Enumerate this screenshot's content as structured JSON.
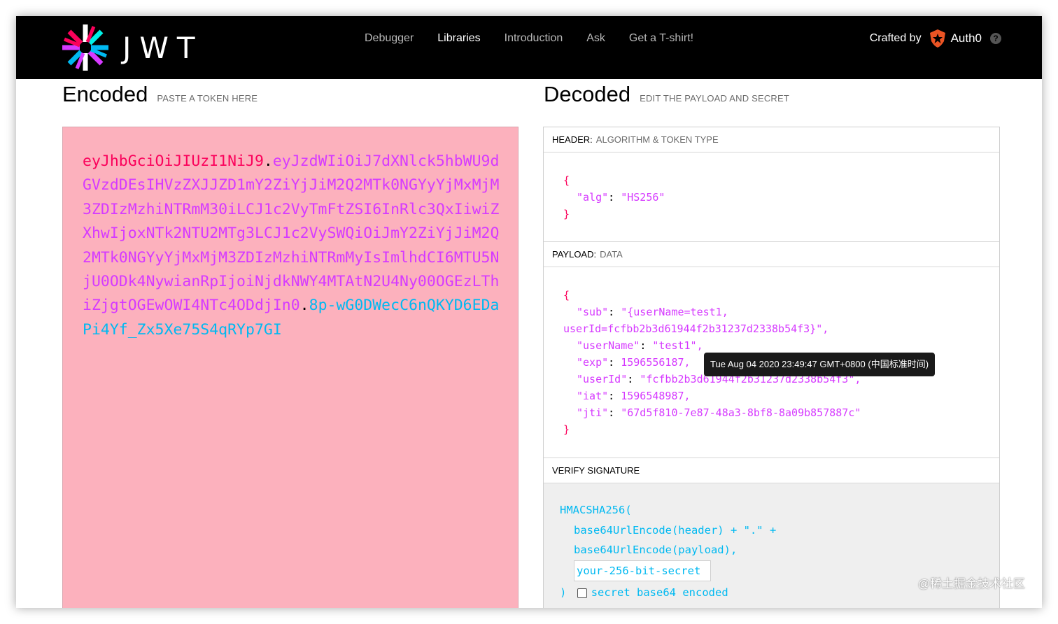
{
  "nav": {
    "logo_text": "JWT",
    "items": [
      {
        "label": "Debugger",
        "active": false
      },
      {
        "label": "Libraries",
        "active": true
      },
      {
        "label": "Introduction",
        "active": false
      },
      {
        "label": "Ask",
        "active": false
      },
      {
        "label": "Get a T-shirt!",
        "active": false
      }
    ],
    "crafted_by": "Crafted by",
    "auth0": "Auth0",
    "help": "?"
  },
  "encoded": {
    "title": "Encoded",
    "subtitle": "PASTE A TOKEN HERE",
    "header_part": "eyJhbGciOiJIUzI1NiJ9",
    "payload_part": "eyJzdWIiOiJ7dXNlck5hbWU9dGVzdDEsIHVzZXJJZD1mY2ZiYjJiM2Q2MTk0NGYyYjMxMjM3ZDIzMzhiNTRmM30iLCJ1c2VyTmFtZSI6InRlc3QxIiwiZXhwIjoxNTk2NTU2MTg3LCJ1c2VySWQiOiJmY2ZiYjJiM2Q2MTk0NGYyYjMxMjM3ZDIzMzhiNTRmMyIsImlhdCI6MTU5NjU0ODk4NywianRpIjoiNjdkNWY4MTAtN2U4Ny00OGEzLThiZjgtOGEwOWI4NTc4ODdjIn0",
    "signature_part": "8p-wG0DWecC6nQKYD6EDaPi4Yf_Zx5Xe75S4qRYp7GI",
    "dot": "."
  },
  "decoded": {
    "title": "Decoded",
    "subtitle": "EDIT THE PAYLOAD AND SECRET",
    "header_section": {
      "label": "HEADER:",
      "sub": "ALGORITHM & TOKEN TYPE"
    },
    "header_json": {
      "alg_key": "\"alg\"",
      "alg_val": "\"HS256\""
    },
    "payload_section": {
      "label": "PAYLOAD:",
      "sub": "DATA"
    },
    "payload_json": {
      "sub_key": "\"sub\"",
      "sub_val_1": "\"{userName=test1,",
      "sub_val_2": "userId=fcfbb2b3d61944f2b31237d2338b54f3}\",",
      "userName_key": "\"userName\"",
      "userName_val": "\"test1\",",
      "exp_key": "\"exp\"",
      "exp_val": "1596556187,",
      "userId_key": "\"userId\"",
      "userId_val": "\"fcfbb2b3d61944f2b31237d2338b54f3\",",
      "iat_key": "\"iat\"",
      "iat_val": "1596548987,",
      "jti_key": "\"jti\"",
      "jti_val": "\"67d5f810-7e87-48a3-8bf8-8a09b857887c\""
    },
    "exp_tooltip": "Tue Aug 04 2020 23:49:47 GMT+0800 (中国标准时间)",
    "verify_section": {
      "label": "VERIFY SIGNATURE"
    },
    "signature": {
      "fn": "HMACSHA256(",
      "line1": "base64UrlEncode(header) + \".\" +",
      "line2": "base64UrlEncode(payload),",
      "secret_value": "your-256-bit-secret",
      "close": ")",
      "base64_label": "secret base64 encoded"
    }
  },
  "watermark": "@稀土掘金技术社区",
  "colors": {
    "header": "#fb015b",
    "payload": "#d63aff",
    "signature": "#00b9f1",
    "encoded_bg": "#fcb1bd"
  }
}
